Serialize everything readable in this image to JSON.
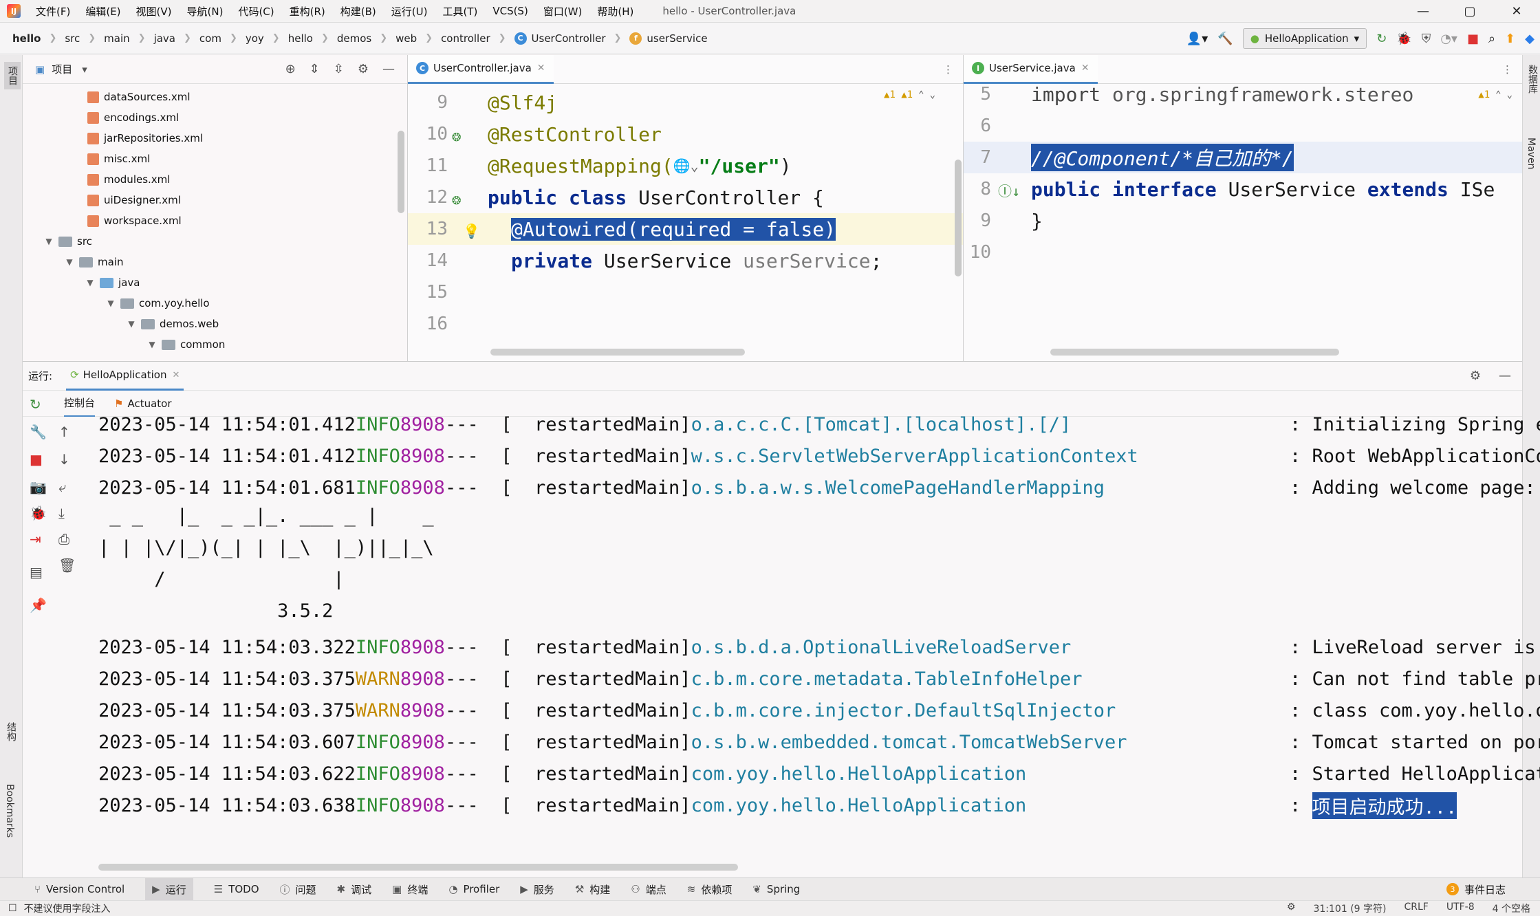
{
  "window": {
    "title": "hello - UserController.java",
    "minimize": "—",
    "maximize": "▢",
    "close": "✕"
  },
  "menu": [
    "文件(F)",
    "编辑(E)",
    "视图(V)",
    "导航(N)",
    "代码(C)",
    "重构(R)",
    "构建(B)",
    "运行(U)",
    "工具(T)",
    "VCS(S)",
    "窗口(W)",
    "帮助(H)"
  ],
  "breadcrumbs": [
    "hello",
    "src",
    "main",
    "java",
    "com",
    "yoy",
    "hello",
    "demos",
    "web",
    "controller",
    "UserController",
    "userService"
  ],
  "toolbar": {
    "run_config": "HelloApplication"
  },
  "left_tabs": {
    "project": "项目",
    "structure": "结构",
    "bookmarks": "Bookmarks"
  },
  "right_tabs": {
    "database": "数据库",
    "maven": "Maven"
  },
  "project": {
    "title": "项目",
    "items": [
      {
        "label": "dataSources.xml",
        "kind": "xml"
      },
      {
        "label": "encodings.xml",
        "kind": "xml"
      },
      {
        "label": "jarRepositories.xml",
        "kind": "xml"
      },
      {
        "label": "misc.xml",
        "kind": "xml"
      },
      {
        "label": "modules.xml",
        "kind": "xml"
      },
      {
        "label": "uiDesigner.xml",
        "kind": "xml"
      },
      {
        "label": "workspace.xml",
        "kind": "xml"
      },
      {
        "label": "src",
        "kind": "folder"
      },
      {
        "label": "main",
        "kind": "folder"
      },
      {
        "label": "java",
        "kind": "folder-blue"
      },
      {
        "label": "com.yoy.hello",
        "kind": "package"
      },
      {
        "label": "demos.web",
        "kind": "package"
      },
      {
        "label": "common",
        "kind": "package"
      }
    ]
  },
  "editor1": {
    "tab": "UserController.java",
    "warnings": "▲1  ▲1",
    "lines": [
      {
        "n": "9",
        "text": "@Slf4j"
      },
      {
        "n": "10",
        "text": "@RestController"
      },
      {
        "n": "11",
        "pre": "@RequestMapping(",
        "str": "\"/user\"",
        "post": ")"
      },
      {
        "n": "12",
        "kw": "public class ",
        "text": "UserController {"
      },
      {
        "n": "13",
        "sel": "@Autowired(required = false)"
      },
      {
        "n": "14",
        "kw": "private ",
        "text": "UserService ",
        "field": "userService",
        ";": ";"
      },
      {
        "n": "15",
        "text": ""
      },
      {
        "n": "16",
        "text": ""
      }
    ]
  },
  "editor2": {
    "tab": "UserService.java",
    "warnings": "▲1",
    "lines": [
      {
        "n": "5",
        "kw": "import ",
        "text": "org.springframework.stereo"
      },
      {
        "n": "6",
        "text": ""
      },
      {
        "n": "7",
        "comment": "//@Component/*自己加的*/"
      },
      {
        "n": "8",
        "kw1": "public interface ",
        "text": "UserService ",
        "kw2": "extends ",
        "tail": "ISe"
      },
      {
        "n": "9",
        "text": "}"
      },
      {
        "n": "10",
        "text": ""
      }
    ]
  },
  "run": {
    "label": "运行:",
    "tab": "HelloApplication",
    "subtabs": [
      "控制台",
      "Actuator"
    ],
    "logs": [
      {
        "ts": "2023-05-14 11:54:01.412",
        "level": "INFO",
        "pid": "8908",
        "thread": "---  [  restartedMain]",
        "logger": "o.a.c.c.C.[Tomcat].[localhost].[/]",
        "msg": ": Initializing Spring em"
      },
      {
        "ts": "2023-05-14 11:54:01.412",
        "level": "INFO",
        "pid": "8908",
        "thread": "---  [  restartedMain]",
        "logger": "w.s.c.ServletWebServerApplicationContext",
        "msg": ": Root WebApplicationCon"
      },
      {
        "ts": "2023-05-14 11:54:01.681",
        "level": "INFO",
        "pid": "8908",
        "thread": "---  [  restartedMain]",
        "logger": "o.s.b.a.w.s.WelcomePageHandlerMapping",
        "msg": ": Adding welcome page: c"
      },
      {
        "ts": "2023-05-14 11:54:03.322",
        "level": "INFO",
        "pid": "8908",
        "thread": "---  [  restartedMain]",
        "logger": "o.s.b.d.a.OptionalLiveReloadServer",
        "msg": ": LiveReload server is r"
      },
      {
        "ts": "2023-05-14 11:54:03.375",
        "level": "WARN",
        "pid": "8908",
        "thread": "---  [  restartedMain]",
        "logger": "c.b.m.core.metadata.TableInfoHelper",
        "msg": ": Can not find table pri"
      },
      {
        "ts": "2023-05-14 11:54:03.375",
        "level": "WARN",
        "pid": "8908",
        "thread": "---  [  restartedMain]",
        "logger": "c.b.m.core.injector.DefaultSqlInjector",
        "msg": ": class com.yoy.hello.de"
      },
      {
        "ts": "2023-05-14 11:54:03.607",
        "level": "INFO",
        "pid": "8908",
        "thread": "---  [  restartedMain]",
        "logger": "o.s.b.w.embedded.tomcat.TomcatWebServer",
        "msg": ": Tomcat started on port"
      },
      {
        "ts": "2023-05-14 11:54:03.622",
        "level": "INFO",
        "pid": "8908",
        "thread": "---  [  restartedMain]",
        "logger": "com.yoy.hello.HelloApplication",
        "msg": ": Started HelloApplicati"
      },
      {
        "ts": "2023-05-14 11:54:03.638",
        "level": "INFO",
        "pid": "8908",
        "thread": "---  [  restartedMain]",
        "logger": "com.yoy.hello.HelloApplication",
        "msg": ": ",
        "msg_sel": "项目启动成功..."
      }
    ],
    "banner": [
      " _ _   |_  _ _|_. ___ _ |    _ ",
      "| | |\\/|_)(_| | |_\\  |_)||_|_\\ ",
      "     /               |          ",
      "                3.5.2"
    ]
  },
  "bottom_tabs": [
    "Version Control",
    "运行",
    "TODO",
    "问题",
    "调试",
    "终端",
    "Profiler",
    "服务",
    "构建",
    "端点",
    "依赖项",
    "Spring"
  ],
  "event_log": {
    "count": "3",
    "label": "事件日志"
  },
  "status": {
    "left": "不建议使用字段注入",
    "position": "31:101 (9 字符)",
    "line_sep": "CRLF",
    "encoding": "UTF-8",
    "indent": "4 个空格"
  }
}
